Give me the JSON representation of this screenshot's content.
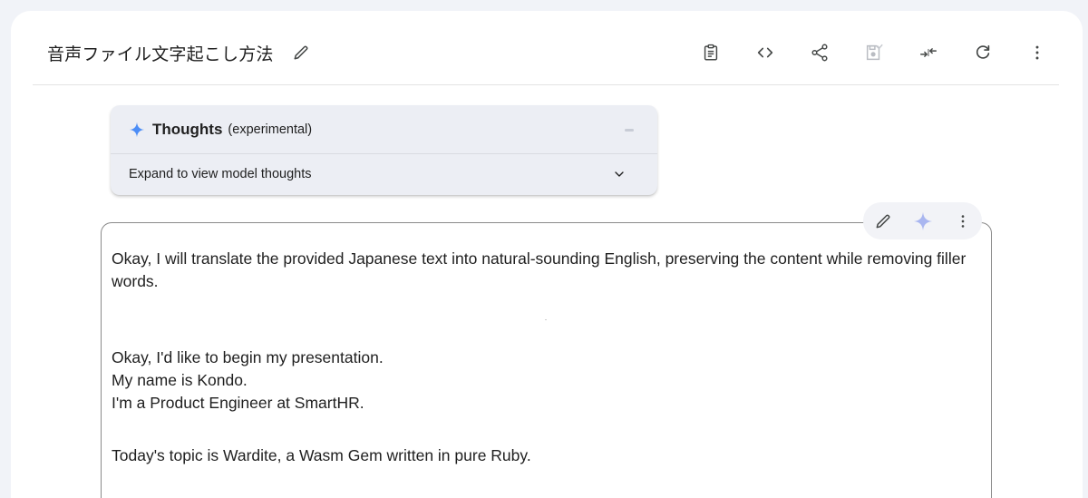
{
  "header": {
    "title": "音声ファイル文字起こし方法",
    "toolbar": [
      {
        "icon": "clipboard-icon",
        "label": ""
      },
      {
        "icon": "code-icon",
        "label": ""
      },
      {
        "icon": "share-icon",
        "label": ""
      },
      {
        "icon": "save-prompt-icon",
        "label": ""
      },
      {
        "icon": "compare-icon",
        "label": ""
      },
      {
        "icon": "refresh-icon",
        "label": ""
      },
      {
        "icon": "more-vert-icon",
        "label": ""
      }
    ]
  },
  "thoughts": {
    "title": "Thoughts",
    "subtitle": "(experimental)",
    "expand_label": "Expand to view model thoughts",
    "accent": "#4c8df6"
  },
  "response": {
    "actions": [
      "edit-icon",
      "sparkle-icon",
      "more-vert-icon"
    ],
    "intro": "Okay, I will translate the provided Japanese text into natural-sounding English, preserving the content while removing filler words.",
    "lines_block1": [
      "Okay, I'd like to begin my presentation.",
      "My name is Kondo.",
      "I'm a Product Engineer at SmartHR."
    ],
    "line_block2": "Today's topic is Wardite, a Wasm Gem written in pure Ruby."
  },
  "colors": {
    "background": "#f1f3f8",
    "card": "#ffffff",
    "thoughts_bg": "#eceef4",
    "icon": "#444746",
    "text": "#1f1f1f"
  }
}
